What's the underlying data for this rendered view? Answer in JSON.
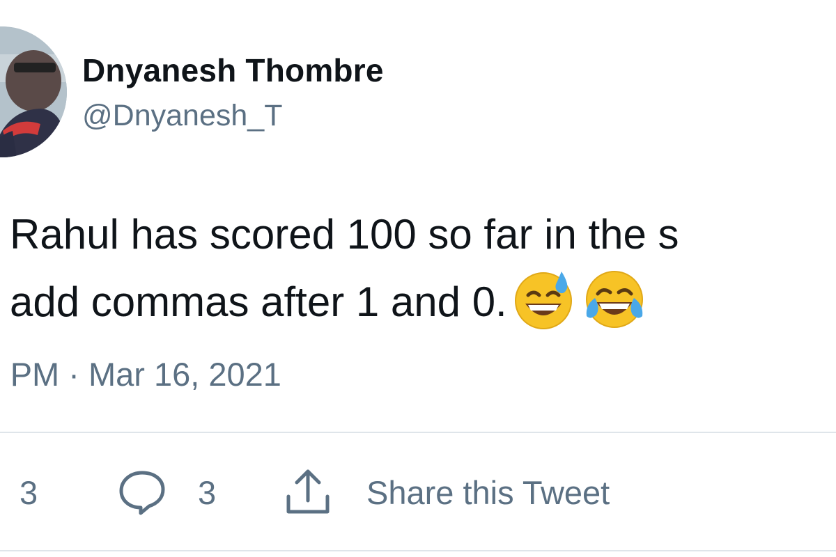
{
  "user": {
    "display_name": "Dnyanesh Thombre",
    "handle": "@Dnyanesh_T"
  },
  "tweet": {
    "line1": "Rahul has scored 100 so far in the s",
    "line2": "add commas after 1 and 0.",
    "emojis": [
      "grinning-face-with-sweat-icon",
      "face-with-tears-of-joy-icon"
    ]
  },
  "timestamp": ") PM · Mar 16, 2021",
  "actions": {
    "like_count": "3",
    "reply_count": "3",
    "share_label": "Share this Tweet"
  },
  "icons": {
    "reply": "speech-bubble-icon",
    "share": "upload-arrow-icon"
  },
  "colors": {
    "text_primary": "#0f1419",
    "text_secondary": "#5b7083",
    "divider": "#dfe5ea"
  }
}
